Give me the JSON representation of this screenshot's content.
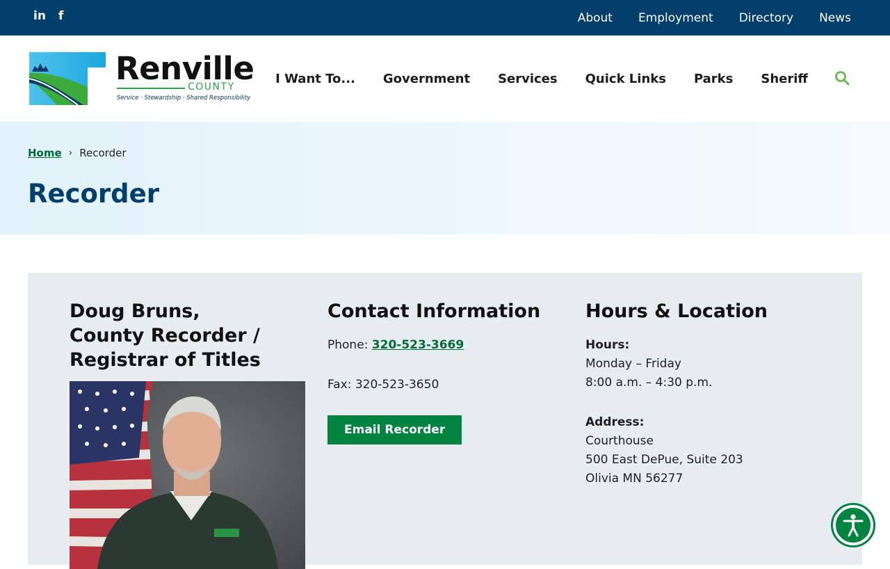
{
  "topbar": {
    "social": [
      {
        "icon": "linkedin-icon",
        "text": "in"
      },
      {
        "icon": "facebook-icon",
        "text": "f"
      }
    ],
    "links": [
      "About",
      "Employment",
      "Directory",
      "News"
    ]
  },
  "logo": {
    "name": "Renville",
    "county": "COUNTY",
    "tagline": "Service · Stewardship · Shared Responsibility"
  },
  "nav": {
    "items": [
      "I Want To...",
      "Government",
      "Services",
      "Quick Links",
      "Parks",
      "Sheriff"
    ],
    "search_icon": "search-icon"
  },
  "breadcrumb": {
    "home": "Home",
    "current": "Recorder"
  },
  "page": {
    "title": "Recorder"
  },
  "profile": {
    "name_line1": "Doug Bruns,",
    "name_line2": "County Recorder /",
    "name_line3": "Registrar of Titles"
  },
  "contact": {
    "heading": "Contact Information",
    "phone_label": "Phone:",
    "phone": "320-523-3669",
    "fax": "Fax: 320-523-3650",
    "email_button": "Email Recorder"
  },
  "hours": {
    "heading": "Hours & Location",
    "hours_label": "Hours:",
    "days": "Monday – Friday",
    "time": "8:00 a.m. – 4:30 p.m.",
    "address_label": "Address:",
    "address_line1": "Courthouse",
    "address_line2": "500 East DePue, Suite 203",
    "address_line3": "Olivia MN 56277"
  },
  "colors": {
    "brand_navy": "#003e6b",
    "brand_green": "#00843f",
    "panel_bg": "#e8edf1"
  }
}
